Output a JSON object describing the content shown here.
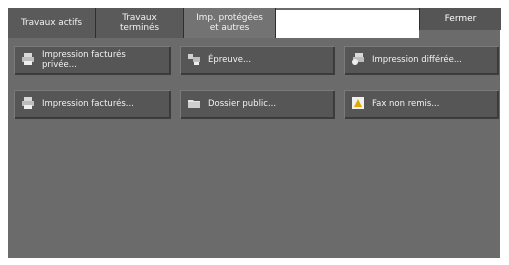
{
  "tabs": [
    {
      "label": "Travaux actifs"
    },
    {
      "label": "Travaux\nterminés"
    },
    {
      "label": "Imp. protégées\net autres"
    }
  ],
  "close_label": "Fermer",
  "buttons": [
    {
      "label": "Impression facturés\nprivée...",
      "icon": "printer-lock-icon"
    },
    {
      "label": "Épreuve...",
      "icon": "proof-print-icon"
    },
    {
      "label": "Impression différée...",
      "icon": "printer-clock-icon"
    },
    {
      "label": "Impression facturés...",
      "icon": "printer-icon"
    },
    {
      "label": "Dossier public...",
      "icon": "folder-icon"
    },
    {
      "label": "Fax non remis...",
      "icon": "fax-warning-icon"
    }
  ]
}
